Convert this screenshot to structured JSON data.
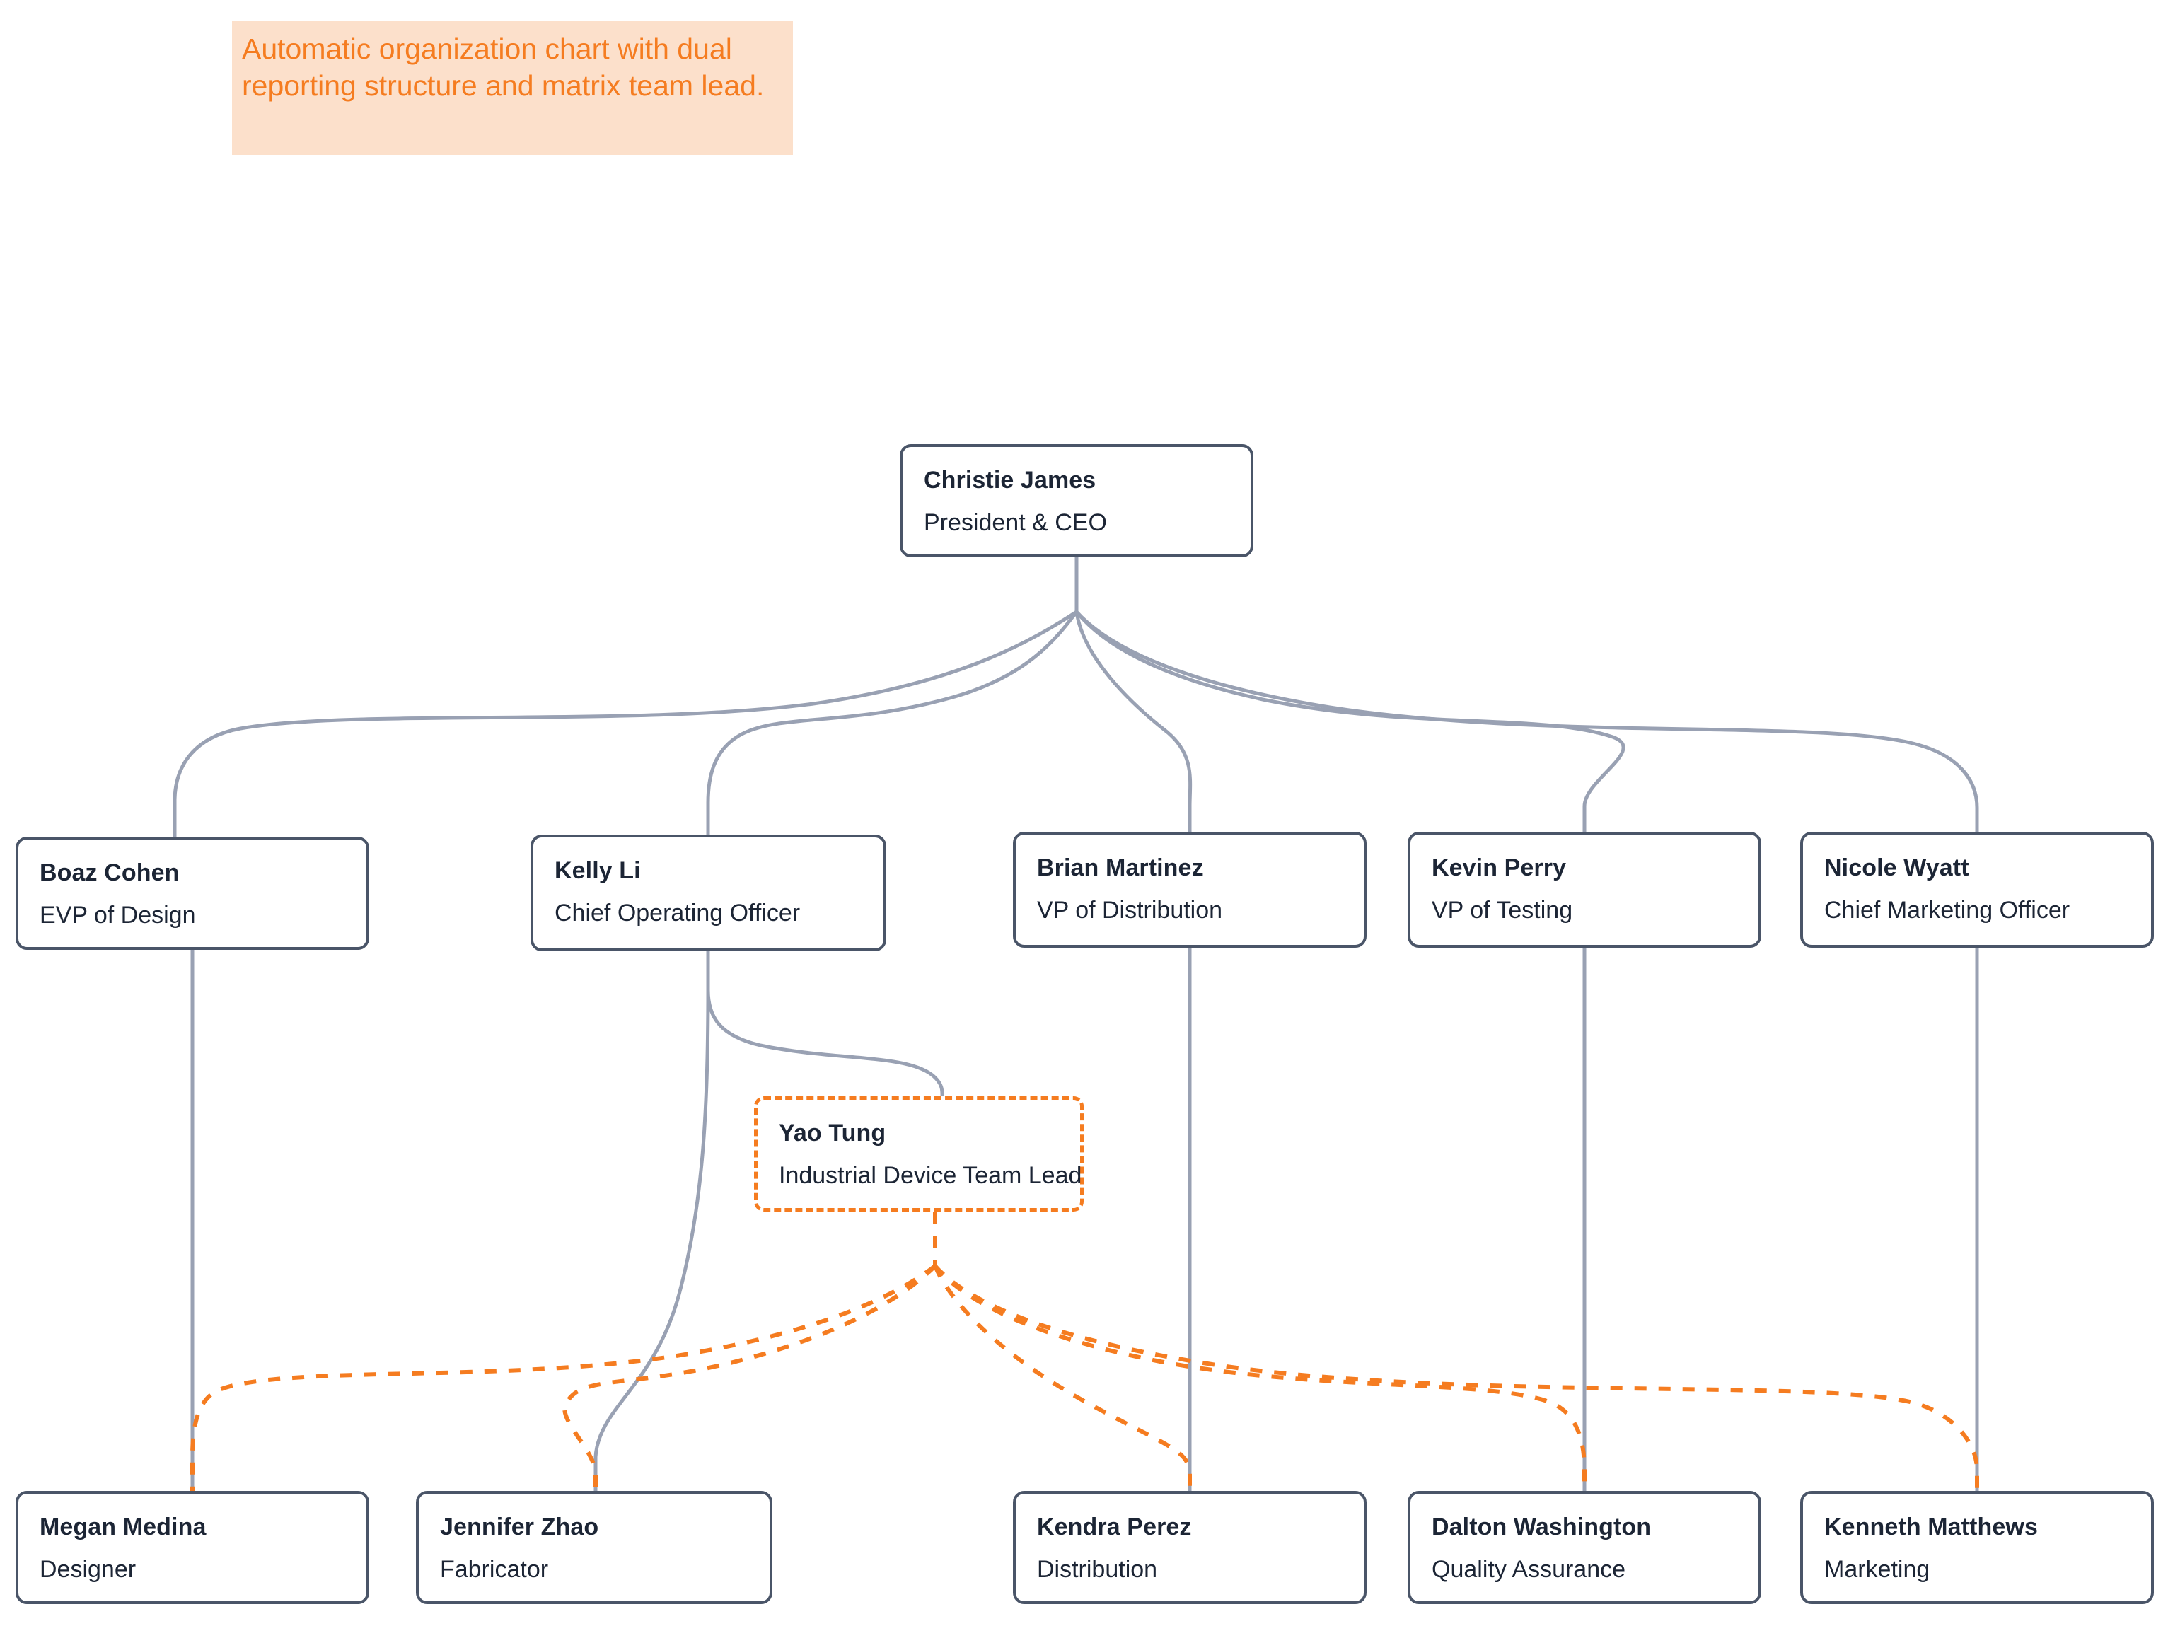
{
  "annotation": {
    "text": "Automatic organization chart with dual reporting structure and matrix team lead.",
    "background_color": "#FCE0CB",
    "text_color": "#F57C20"
  },
  "colors": {
    "node_border": "#4A5568",
    "node_text": "#1C2535",
    "solid_edge": "#99A1B3",
    "matrix_edge": "#F57C20",
    "canvas_background": "#FFFFFF"
  },
  "chart_data": {
    "type": "diagram",
    "title": "Automatic organization chart with dual reporting structure and matrix team lead.",
    "nodes": [
      {
        "id": "christie",
        "name": "Christie James",
        "title": "President & CEO",
        "level": 0,
        "style": "solid"
      },
      {
        "id": "boaz",
        "name": "Boaz Cohen",
        "title": "EVP of Design",
        "level": 1,
        "style": "solid"
      },
      {
        "id": "kelly",
        "name": "Kelly Li",
        "title": "Chief Operating Officer",
        "level": 1,
        "style": "solid"
      },
      {
        "id": "brian",
        "name": "Brian Martinez",
        "title": "VP of Distribution",
        "level": 1,
        "style": "solid"
      },
      {
        "id": "kevin",
        "name": "Kevin Perry",
        "title": "VP of Testing",
        "level": 1,
        "style": "solid"
      },
      {
        "id": "nicole",
        "name": "Nicole Wyatt",
        "title": "Chief Marketing Officer",
        "level": 1,
        "style": "solid"
      },
      {
        "id": "yao",
        "name": "Yao Tung",
        "title": "Industrial Device Team Lead",
        "level": 2,
        "style": "dashed"
      },
      {
        "id": "megan",
        "name": "Megan Medina",
        "title": "Designer",
        "level": 3,
        "style": "solid"
      },
      {
        "id": "jennifer",
        "name": "Jennifer Zhao",
        "title": "Fabricator",
        "level": 3,
        "style": "solid"
      },
      {
        "id": "kendra",
        "name": "Kendra Perez",
        "title": "Distribution",
        "level": 3,
        "style": "solid"
      },
      {
        "id": "dalton",
        "name": "Dalton Washington",
        "title": "Quality Assurance",
        "level": 3,
        "style": "solid"
      },
      {
        "id": "kenneth",
        "name": "Kenneth Matthews",
        "title": "Marketing",
        "level": 3,
        "style": "solid"
      }
    ],
    "edges": [
      {
        "from": "christie",
        "to": "boaz",
        "style": "solid"
      },
      {
        "from": "christie",
        "to": "kelly",
        "style": "solid"
      },
      {
        "from": "christie",
        "to": "brian",
        "style": "solid"
      },
      {
        "from": "christie",
        "to": "kevin",
        "style": "solid"
      },
      {
        "from": "christie",
        "to": "nicole",
        "style": "solid"
      },
      {
        "from": "boaz",
        "to": "megan",
        "style": "solid"
      },
      {
        "from": "kelly",
        "to": "yao",
        "style": "solid"
      },
      {
        "from": "kelly",
        "to": "jennifer",
        "style": "solid"
      },
      {
        "from": "brian",
        "to": "kendra",
        "style": "solid"
      },
      {
        "from": "kevin",
        "to": "dalton",
        "style": "solid"
      },
      {
        "from": "nicole",
        "to": "kenneth",
        "style": "solid"
      },
      {
        "from": "yao",
        "to": "megan",
        "style": "dashed"
      },
      {
        "from": "yao",
        "to": "jennifer",
        "style": "dashed"
      },
      {
        "from": "yao",
        "to": "kendra",
        "style": "dashed"
      },
      {
        "from": "yao",
        "to": "dalton",
        "style": "dashed"
      },
      {
        "from": "yao",
        "to": "kenneth",
        "style": "dashed"
      }
    ]
  },
  "nodes": {
    "christie": {
      "name": "Christie James",
      "title": "President & CEO"
    },
    "boaz": {
      "name": "Boaz Cohen",
      "title": "EVP of Design"
    },
    "kelly": {
      "name": "Kelly Li",
      "title": "Chief Operating Officer"
    },
    "brian": {
      "name": "Brian Martinez",
      "title": "VP of Distribution"
    },
    "kevin": {
      "name": "Kevin Perry",
      "title": "VP of Testing"
    },
    "nicole": {
      "name": "Nicole Wyatt",
      "title": "Chief Marketing Officer"
    },
    "yao": {
      "name": "Yao Tung",
      "title": "Industrial Device Team Lead"
    },
    "megan": {
      "name": "Megan Medina",
      "title": "Designer"
    },
    "jennifer": {
      "name": "Jennifer Zhao",
      "title": "Fabricator"
    },
    "kendra": {
      "name": "Kendra Perez",
      "title": "Distribution"
    },
    "dalton": {
      "name": "Dalton Washington",
      "title": "Quality Assurance"
    },
    "kenneth": {
      "name": "Kenneth Matthews",
      "title": "Marketing"
    }
  }
}
